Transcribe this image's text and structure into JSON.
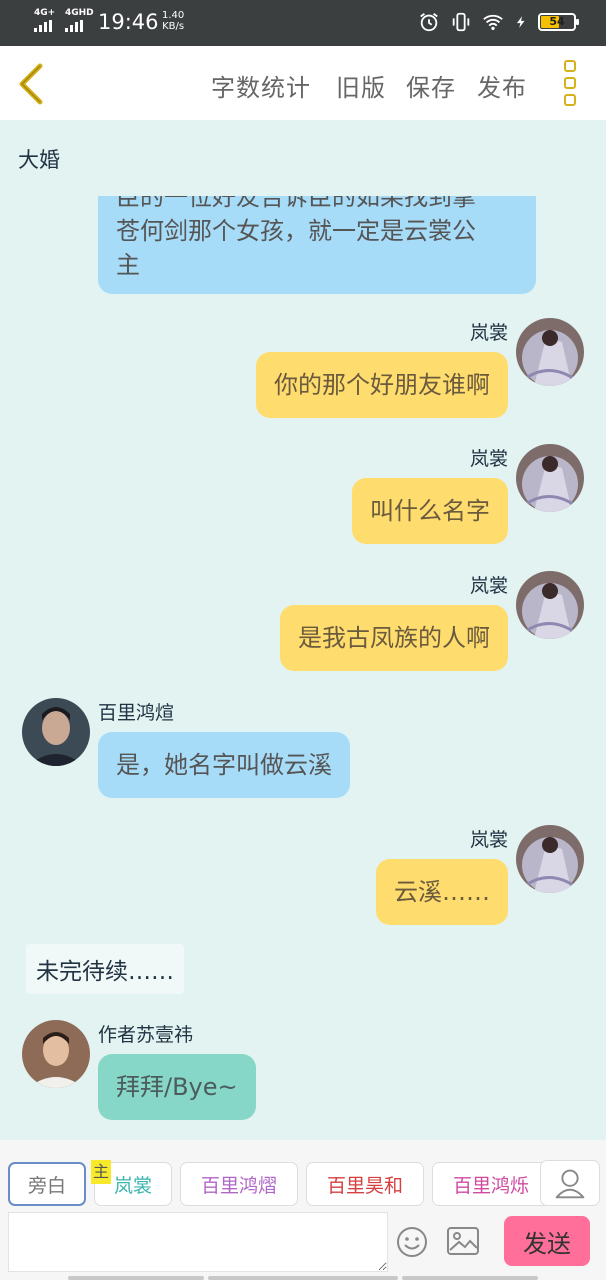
{
  "status": {
    "net1": "4G+",
    "net2": "4GHD",
    "time": "19:46",
    "speed_value": "1.40",
    "speed_unit": "KB/s",
    "battery": "54",
    "icons": [
      "alarm-icon",
      "vibrate-icon",
      "wifi-icon",
      "charging-icon",
      "battery-icon"
    ]
  },
  "toolbar": {
    "back_icon": "chevron-left-icon",
    "word_count": "字数统计",
    "old_version": "旧版",
    "save": "保存",
    "publish": "发布",
    "more_icon": "more-vertical-icon",
    "accent": "#d6b21a"
  },
  "chat": {
    "title": "大婚",
    "messages": [
      {
        "side": "left",
        "style": "blue",
        "name": "",
        "text_lines": [
          "臣的一位好友告诉臣的如果找到掌",
          "苍何剑那个女孩，就一定是云裳公",
          "主"
        ]
      },
      {
        "side": "right",
        "style": "yellow",
        "name": "岚裳",
        "text": "你的那个好朋友谁啊"
      },
      {
        "side": "right",
        "style": "yellow",
        "name": "岚裳",
        "text": "叫什么名字"
      },
      {
        "side": "right",
        "style": "yellow",
        "name": "岚裳",
        "text": "是我古凤族的人啊"
      },
      {
        "side": "left",
        "style": "blue",
        "name": "百里鸿煊",
        "text": "是，她名字叫做云溪"
      },
      {
        "side": "right",
        "style": "yellow",
        "name": "岚裳",
        "text": "云溪……"
      },
      {
        "side": "narration",
        "text": "未完待续……"
      },
      {
        "side": "left",
        "style": "teal",
        "name": "作者苏壹祎",
        "text": "拜拜/Bye~"
      }
    ]
  },
  "characters": {
    "narration": "旁白",
    "main_badge": "主",
    "list": [
      {
        "label": "岚裳",
        "color": "#3ab5b0"
      },
      {
        "label": "百里鸿熠",
        "color": "#b067c8"
      },
      {
        "label": "百里昊和",
        "color": "#d64040"
      },
      {
        "label": "百里鸿烁",
        "color": "#d14aa0"
      }
    ],
    "user_icon": "user-icon"
  },
  "input": {
    "placeholder": "",
    "emoji_icon": "smiley-icon",
    "image_icon": "image-icon",
    "send": "发送",
    "send_color": "#ff6f99"
  },
  "colors": {
    "chat_bg": "#e2f3f1",
    "left_bubble": "#a7dcf8",
    "right_bubble": "#ffdc6e",
    "author_bubble": "#86d7c8"
  }
}
